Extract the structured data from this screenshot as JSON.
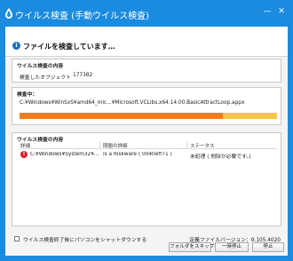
{
  "window": {
    "title": "ウイルス検査 (手動ウイルス検査)",
    "minimize_glyph": "—",
    "close_glyph": "✕"
  },
  "header": {
    "status_text": "ファイルを検査しています…",
    "icon_glyph": "i"
  },
  "scan_content": {
    "group_title": "ウイルス検査の内容",
    "objects_label": "検査したオブジェクト",
    "objects_value": "177382"
  },
  "scanning": {
    "group_title": "検査中：",
    "current_path": "C:¥Windows¥WinSxS¥amd64_mic...¥Microsoft.VCLibs.x64.14.00.BasicAttractLoop.appx",
    "progress_fraction": 0.79,
    "colors": {
      "fill": "#ef7d1f",
      "track": "#f6c34d"
    }
  },
  "results": {
    "group_title": "ウイルス検査の内容",
    "columns": [
      "詳細",
      "問題の詳細",
      "ステータス"
    ],
    "rows": [
      {
        "detail": "C:¥Windows¥System32¥...",
        "problem": "is a Riskware ( 0040eff71 )",
        "status": "未処理 ( 削除が必要です。)",
        "icon_glyph": "!"
      }
    ]
  },
  "options": {
    "shutdown_label": "ウイルス検査終了後にパソコンをシャットダウンする",
    "shutdown_checked": false
  },
  "defs": {
    "version_text": "定義ファイルバージョン：9.105.4020"
  },
  "buttons": {
    "skip_folder": "フォルダをスキップ",
    "pause": "一時停止",
    "stop": "停止"
  },
  "colors": {
    "title_bar": "#1b8be0",
    "accent_error": "#d6202a",
    "info": "#1a6fc2"
  }
}
